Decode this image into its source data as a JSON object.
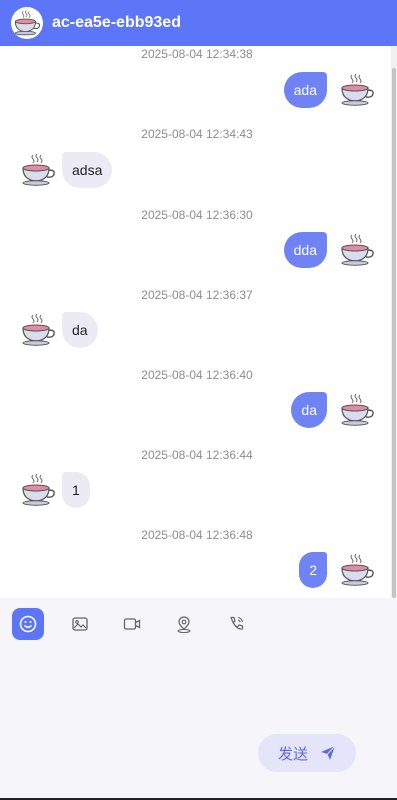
{
  "header": {
    "title": "ac-ea5e-ebb93ed",
    "avatar_icon": "teacup-icon"
  },
  "messages": [
    {
      "timestamp": "2025-08-04 12:34:38",
      "direction": "out",
      "text": "ada"
    },
    {
      "timestamp": "2025-08-04 12:34:43",
      "direction": "in",
      "text": "adsa"
    },
    {
      "timestamp": "2025-08-04 12:36:30",
      "direction": "out",
      "text": "dda"
    },
    {
      "timestamp": "2025-08-04 12:36:37",
      "direction": "in",
      "text": "da"
    },
    {
      "timestamp": "2025-08-04 12:36:40",
      "direction": "out",
      "text": "da"
    },
    {
      "timestamp": "2025-08-04 12:36:44",
      "direction": "in",
      "text": "1"
    },
    {
      "timestamp": "2025-08-04 12:36:48",
      "direction": "out",
      "text": "2"
    }
  ],
  "toolbar": {
    "tools": [
      "emoji-icon",
      "image-icon",
      "video-icon",
      "location-icon",
      "phone-icon"
    ],
    "active": "emoji-icon"
  },
  "composer": {
    "send_label": "发送",
    "send_icon": "send-icon"
  },
  "colors": {
    "accent": "#5d76f8",
    "bubble_out": "#6f83f5",
    "bubble_in": "#ecebf5"
  }
}
